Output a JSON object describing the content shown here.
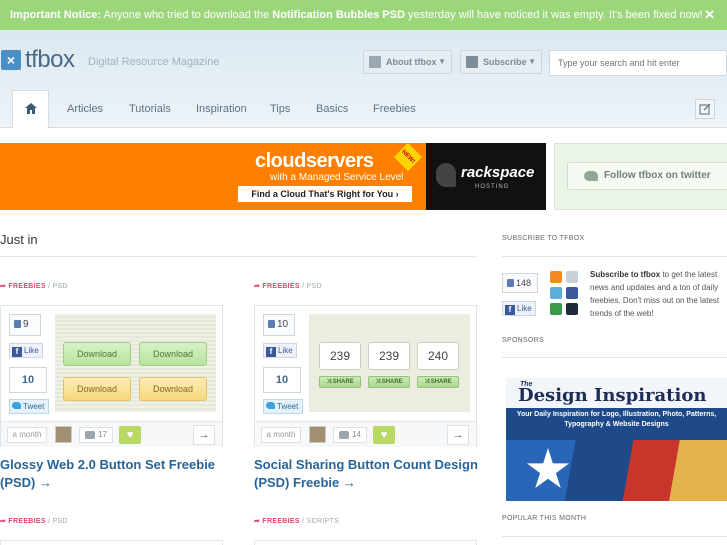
{
  "notice": {
    "label": "Important Notice:",
    "text_before": " Anyone who tried to download the ",
    "link": "Notification Bubbles PSD",
    "text_after": " yesterday will have noticed it was empty. It's been fixed now!",
    "close": "✕"
  },
  "header": {
    "logo_mark": "×",
    "logo_text": "tfbox",
    "tagline": "Digital Resource Magazine",
    "about_label": "About tfbox",
    "subscribe_label": "Subscribe",
    "caret": "▼",
    "search_placeholder": "Type your search and hit enter"
  },
  "nav": {
    "items": [
      "Articles",
      "Tutorials",
      "Inspiration",
      "Tips",
      "Basics",
      "Freebies"
    ]
  },
  "banner": {
    "brand": "cloudservers",
    "sub": "with a Managed Service Level",
    "cta": "Find a Cloud That's Right for You ›",
    "badge": "NEW!",
    "partner": "rackspace",
    "partner_sub": "HOSTING"
  },
  "twitter": {
    "label": "Follow tfbox on twitter"
  },
  "main": {
    "title": "Just in",
    "posts": [
      {
        "category": "FREEBIES",
        "subcategory": "PSD",
        "like_count": "9",
        "like_label": "Like",
        "tweet_count": "10",
        "tweet_label": "Tweet",
        "buttons": [
          "Download",
          "Download",
          "Download",
          "Download"
        ],
        "time": "a month",
        "comments": "17",
        "title": "Glossy Web 2.0 Button Set Freebie (PSD) →"
      },
      {
        "category": "FREEBIES",
        "subcategory": "PSD",
        "like_count": "10",
        "like_label": "Like",
        "tweet_count": "10",
        "tweet_label": "Tweet",
        "counts": [
          "239",
          "239",
          "240"
        ],
        "share_label": "⤨ SHARE",
        "time": "a month",
        "comments": "14",
        "title": "Social Sharing Button Count Design (PSD) Freebie →"
      },
      {
        "category": "FREEBIES",
        "subcategory": "PSD"
      },
      {
        "category": "FREEBIES",
        "subcategory": "SCRIPTS"
      }
    ]
  },
  "sidebar": {
    "subscribe_heading": "SUBSCRIBE TO TFBOX",
    "like_count": "148",
    "like_label": "Like",
    "sub_bold": "Subscribe to tfbox",
    "sub_text": " to get the latest news and updates and a ton of daily freebies. Don't miss out on the latest trends of the web!",
    "sponsors_heading": "SPONSORS",
    "ad_the": "The",
    "ad_name": "Design Inspiration",
    "ad_sub": "Your Daily Inspiration for Logo, Illustration, Photo, Patterns, Typography & Website Designs",
    "popular_heading": "POPULAR THIS MONTH"
  },
  "colors": {
    "accent": "#27649a",
    "notice": "#9bd67a",
    "category": "#e0476e",
    "banner": "#ff7f00"
  }
}
